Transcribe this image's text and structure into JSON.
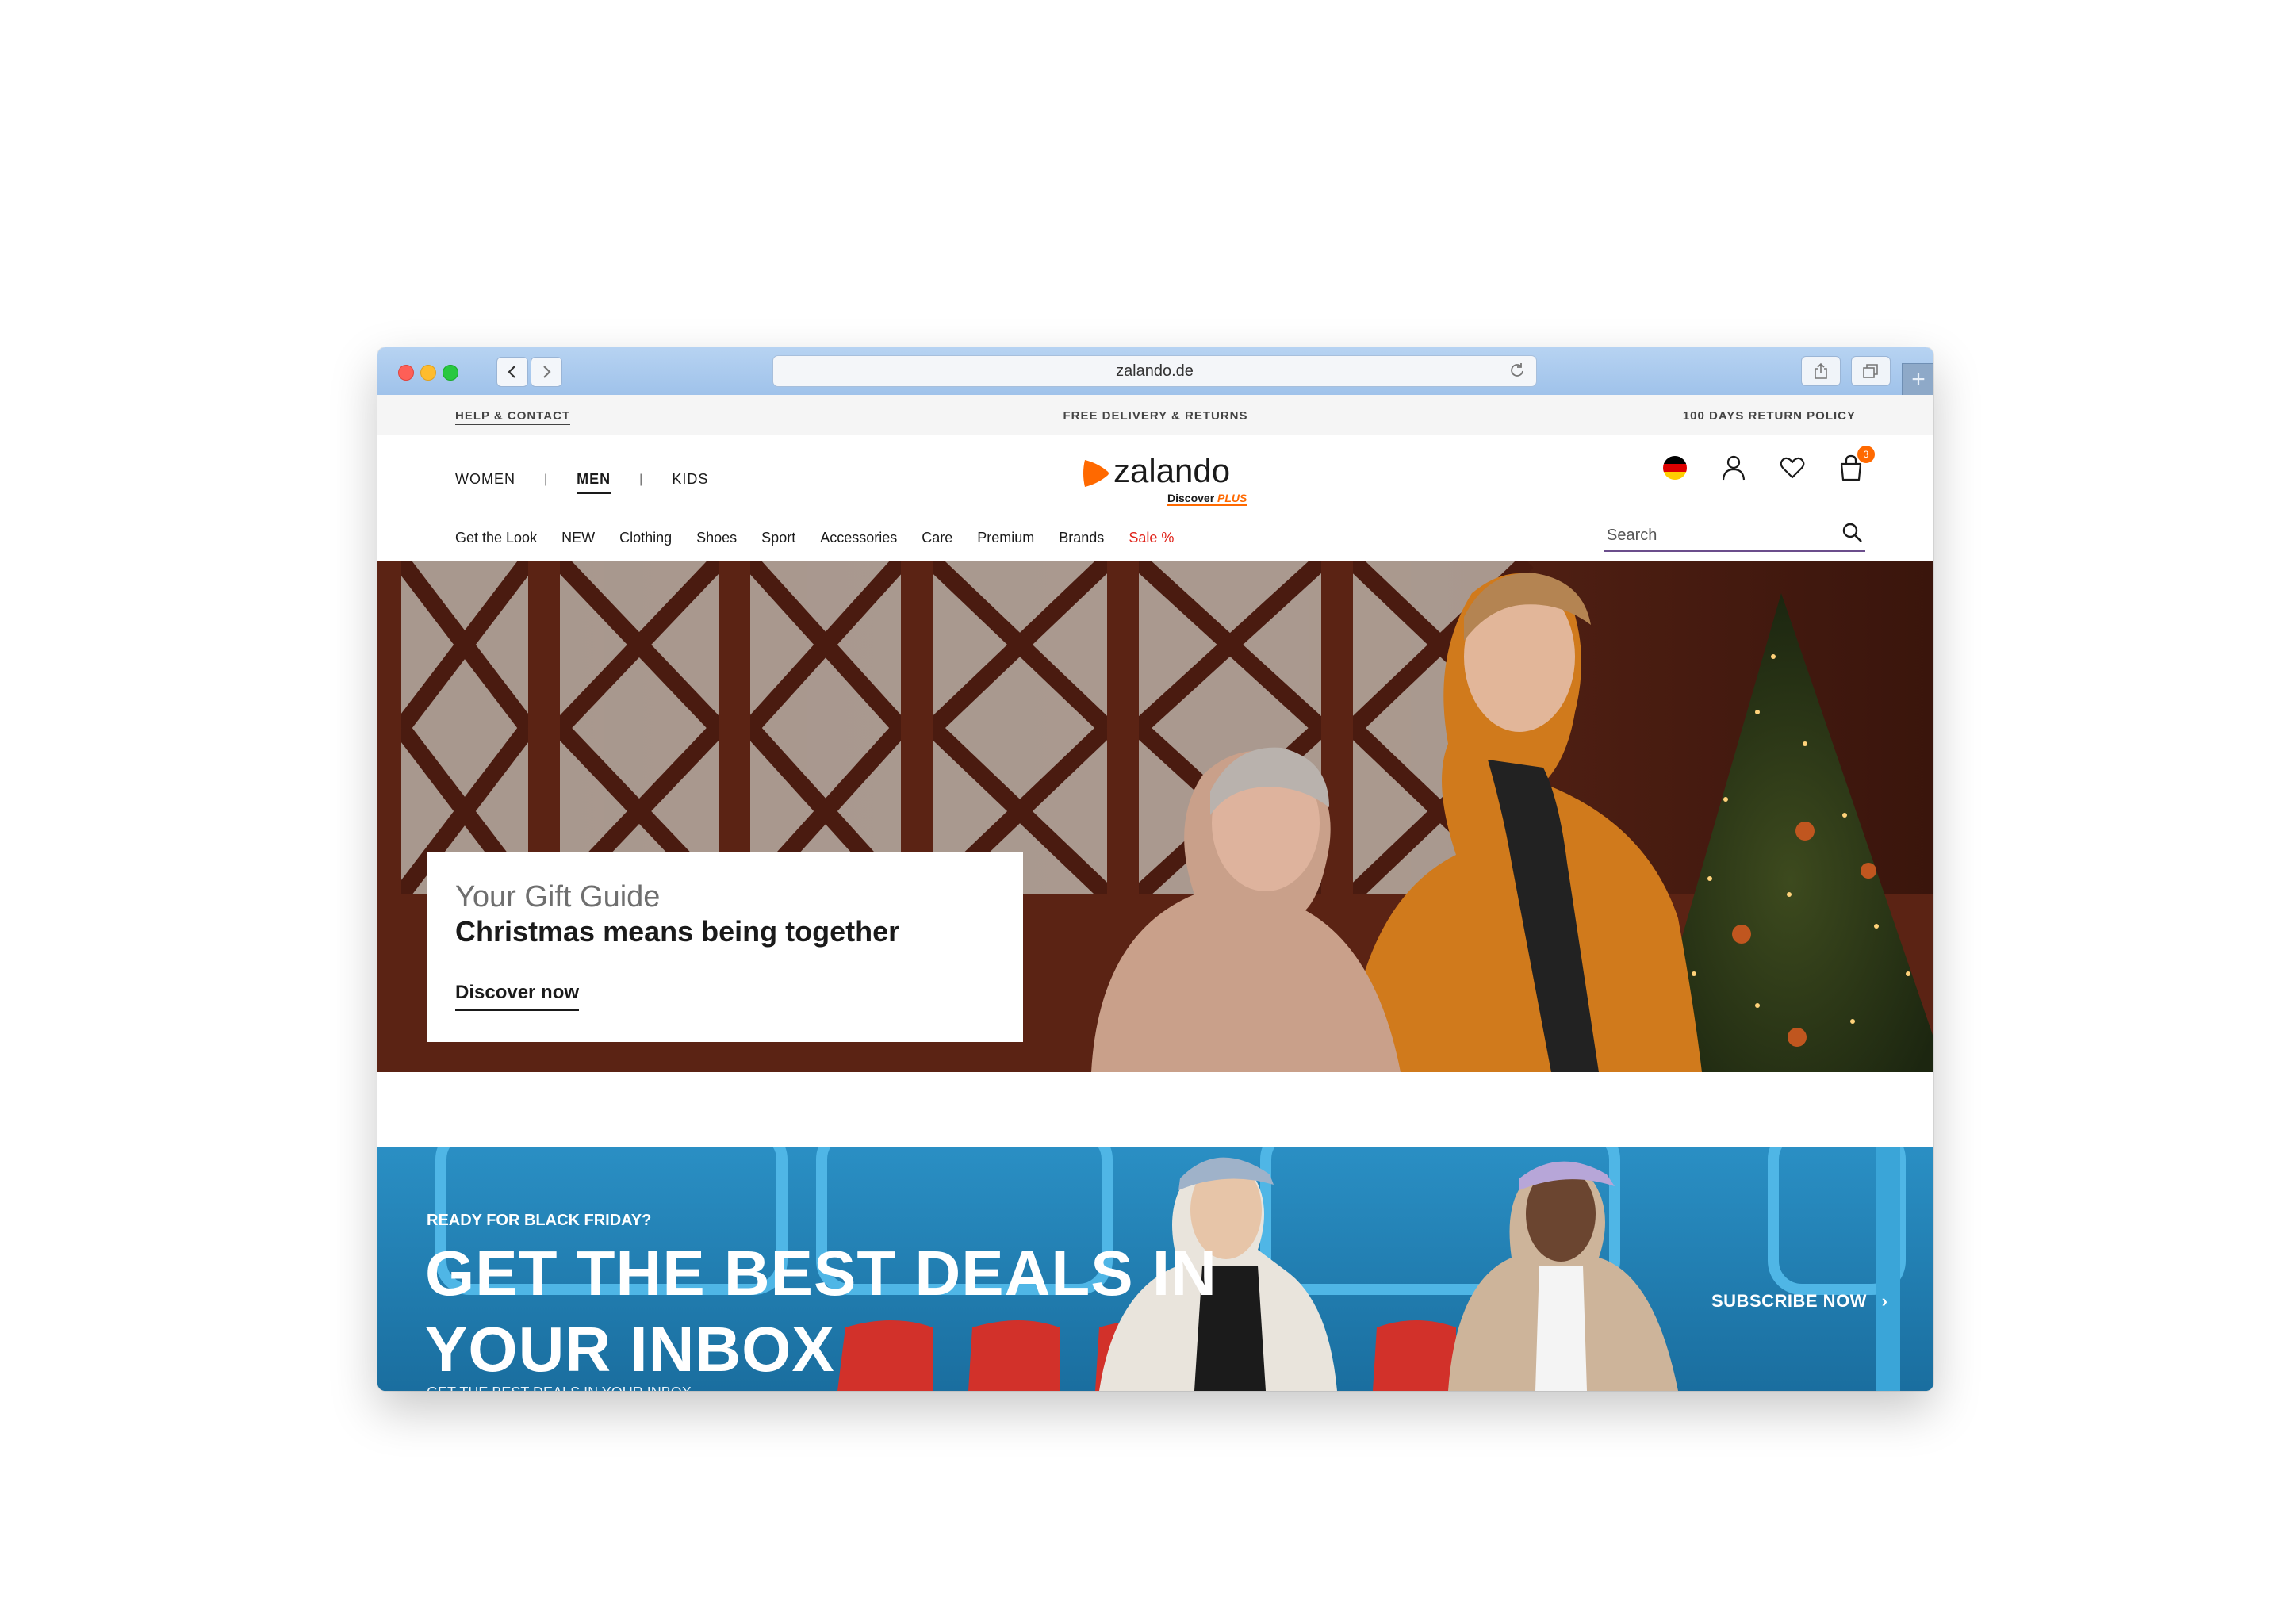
{
  "browser": {
    "url": "zalando.de"
  },
  "topbar": {
    "help": "HELP & CONTACT",
    "delivery": "FREE DELIVERY & RETURNS",
    "returns": "100 DAYS RETURN POLICY"
  },
  "header": {
    "gender_tabs": [
      {
        "label": "WOMEN"
      },
      {
        "label": "MEN",
        "active": true
      },
      {
        "label": "KIDS"
      }
    ],
    "separator": "|",
    "logo": {
      "word": "zalando",
      "discover": "Discover",
      "plus": "PLUS"
    },
    "cart_count": "3"
  },
  "category_nav": [
    "Get the Look",
    "NEW",
    "Clothing",
    "Shoes",
    "Sport",
    "Accessories",
    "Care",
    "Premium",
    "Brands",
    "Sale %"
  ],
  "search": {
    "placeholder": "Search"
  },
  "hero": {
    "kicker": "Your Gift Guide",
    "headline": "Christmas means being together",
    "cta": "Discover now"
  },
  "promo": {
    "kicker": "READY FOR BLACK FRIDAY?",
    "headline": "GET THE BEST DEALS IN YOUR INBOX",
    "subline": "GET THE BEST DEALS IN YOUR INBOX",
    "cta": "SUBSCRIBE NOW",
    "cta_arrow": "›"
  },
  "colors": {
    "brand_orange": "#ff6900",
    "sale_red": "#e0241b",
    "promo_blue": "#1f7fb3"
  }
}
